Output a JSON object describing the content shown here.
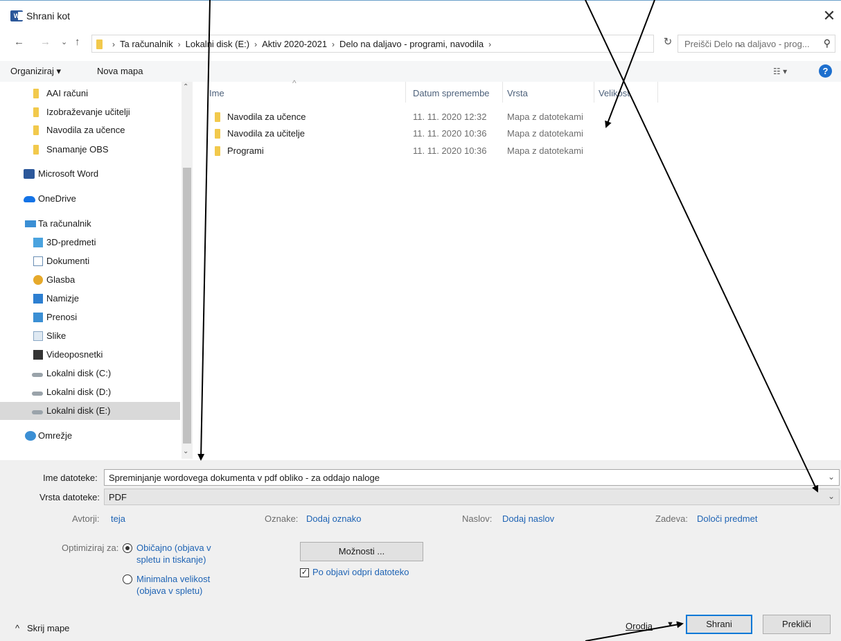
{
  "window": {
    "title": "Shrani kot",
    "app_icon": "word-icon",
    "close": "✕"
  },
  "address": {
    "crumbs": [
      "Ta računalnik",
      "Lokalni disk (E:)",
      "Aktiv 2020-2021",
      "Delo na daljavo - programi, navodila"
    ],
    "search_placeholder": "Preišči Delo na daljavo - prog..."
  },
  "toolbar": {
    "organize": "Organiziraj ▾",
    "new_folder": "Nova mapa"
  },
  "nav": {
    "items": [
      {
        "label": "AAI računi",
        "icon": "folder-icon"
      },
      {
        "label": "Izobraževanje učitelji",
        "icon": "folder-icon"
      },
      {
        "label": "Navodila za učence",
        "icon": "folder-icon"
      },
      {
        "label": "Snamanje OBS",
        "icon": "folder-icon"
      },
      {
        "label": "Microsoft Word",
        "icon": "word-icon"
      },
      {
        "label": "OneDrive",
        "icon": "cloud-icon"
      },
      {
        "label": "Ta računalnik",
        "icon": "computer-icon"
      },
      {
        "label": "3D-predmeti",
        "icon": "cube-icon"
      },
      {
        "label": "Dokumenti",
        "icon": "document-icon"
      },
      {
        "label": "Glasba",
        "icon": "music-icon"
      },
      {
        "label": "Namizje",
        "icon": "desktop-icon"
      },
      {
        "label": "Prenosi",
        "icon": "download-icon"
      },
      {
        "label": "Slike",
        "icon": "pictures-icon"
      },
      {
        "label": "Videoposnetki",
        "icon": "video-icon"
      },
      {
        "label": "Lokalni disk (C:)",
        "icon": "disk-icon"
      },
      {
        "label": "Lokalni disk (D:)",
        "icon": "disk-icon"
      },
      {
        "label": "Lokalni disk (E:)",
        "icon": "disk-icon"
      },
      {
        "label": "Omrežje",
        "icon": "network-icon"
      }
    ]
  },
  "files": {
    "columns": [
      "Ime",
      "Datum spremembe",
      "Vrsta",
      "Velikost"
    ],
    "rows": [
      {
        "name": "Navodila za učence",
        "date": "11. 11. 2020 12:32",
        "type": "Mapa z datotekami"
      },
      {
        "name": "Navodila za učitelje",
        "date": "11. 11. 2020 10:36",
        "type": "Mapa z datotekami"
      },
      {
        "name": "Programi",
        "date": "11. 11. 2020 10:36",
        "type": "Mapa z datotekami"
      }
    ]
  },
  "save": {
    "filename_label": "Ime datoteke:",
    "filename_value": "Spreminjanje wordovega dokumenta v pdf obliko - za oddajo naloge",
    "filetype_label": "Vrsta datoteke:",
    "filetype_value": "PDF",
    "authors_label": "Avtorji:",
    "authors_value": "teja",
    "tags_label": "Oznake:",
    "tags_value": "Dodaj oznako",
    "title_label": "Naslov:",
    "title_value": "Dodaj naslov",
    "subject_label": "Zadeva:",
    "subject_value": "Določi predmet",
    "optimize_label": "Optimiziraj za:",
    "opt1_line1": "Običajno (objava v",
    "opt1_line2": "spletu in tiskanje)",
    "opt2_line1": "Minimalna velikost",
    "opt2_line2": "(objava v spletu)",
    "options_button": "Možnosti ...",
    "open_after": "Po objavi odpri datoteko",
    "hide_folders": "Skrij mape",
    "tools": "Orodja",
    "save_button": "Shrani",
    "cancel_button": "Prekliči"
  }
}
